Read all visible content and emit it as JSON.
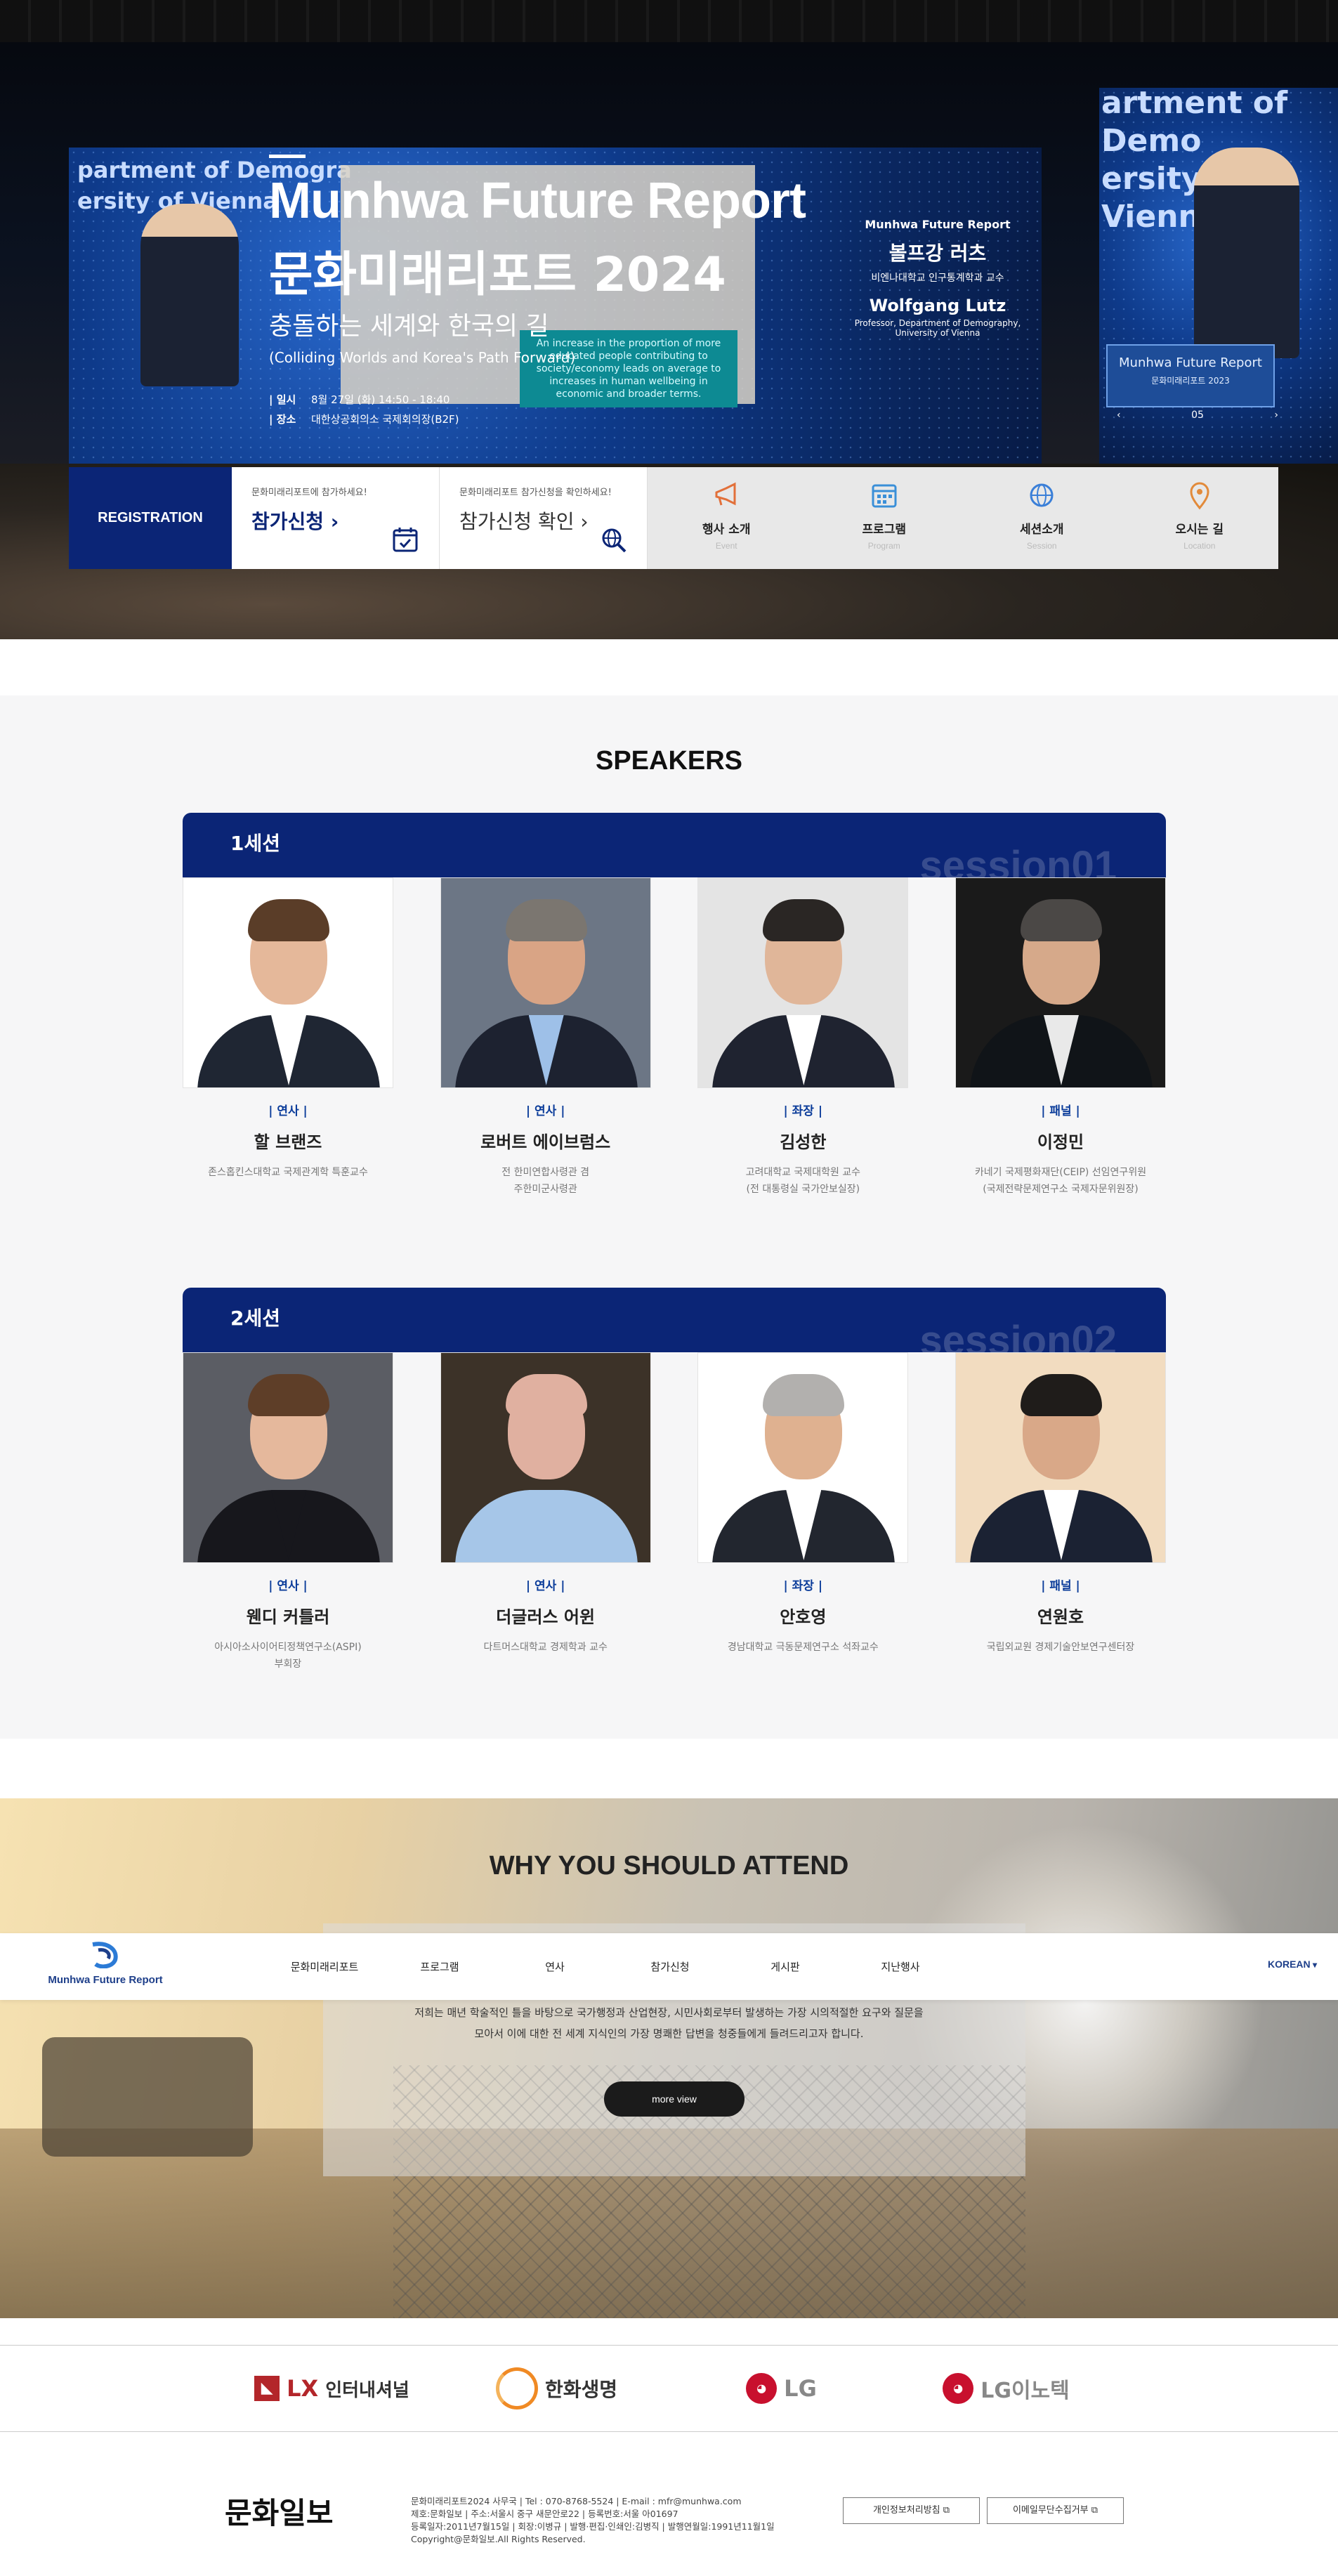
{
  "hero": {
    "title_en": "Munhwa Future Report",
    "title_ko": "문화미래리포트 2024",
    "subtitle_ko": "충돌하는 세계와 한국의 길",
    "subtitle_en": "(Colliding Worlds and Korea's Path Forward)",
    "date_label": "일시",
    "date_value": "8월 27일 (화) 14:50 - 18:40",
    "place_label": "장소",
    "place_value": "대한상공회의소 국제회의장(B2F)",
    "screen_left_text": "partment of Demogra\nersity of Vienna",
    "screen_side_text": "artment of Demo\nersity of Vienna",
    "screen_card": "Munhwa Future Report",
    "screen_card_sub": "문화미래리포트 2023",
    "pager_current": "05",
    "slide_text": "An increase in the proportion of more educated people contributing to society/economy leads on average to increases in human wellbeing in economic and broader terms.",
    "speaker_slide": {
      "brand": "Munhwa Future Report",
      "name_ko": "볼프강 러츠",
      "affil_ko": "비엔나대학교 인구통계학과 교수",
      "name_en": "Wolfgang Lutz",
      "affil_en": "Professor, Department of Demography, University of Vienna"
    }
  },
  "quickbar": {
    "registration": "REGISTRATION",
    "apply_small": "문화미래리포트에 참가하세요!",
    "apply_big": "참가신청 ›",
    "check_small": "문화미래리포트 참가신청을 확인하세요!",
    "check_big": "참가신청 확인 ›",
    "cells": [
      {
        "label": "행사 소개",
        "sub": "Event",
        "icon": "megaphone-icon",
        "color": "#e2703a"
      },
      {
        "label": "프로그램",
        "sub": "Program",
        "icon": "calendar-icon",
        "color": "#3a8fd8"
      },
      {
        "label": "세션소개",
        "sub": "Session",
        "icon": "globe-icon",
        "color": "#3a7fd8"
      },
      {
        "label": "오시는 길",
        "sub": "Location",
        "icon": "location-pin-icon",
        "color": "#e28a3a"
      }
    ]
  },
  "speakers": {
    "title": "SPEAKERS",
    "sessions": [
      {
        "label": "1세션",
        "watermark": "session01",
        "people": [
          {
            "role": "연사",
            "name": "할 브랜즈",
            "desc": "존스홉킨스대학교 국제관계학 특훈교수",
            "bg": "#ffffff",
            "skin": "#e5b89a",
            "hair": "#5a3d28",
            "suit": "#1f2633",
            "shirt": "#ffffff"
          },
          {
            "role": "연사",
            "name": "로버트 에이브럼스",
            "desc": "전 한미연합사령관 겸\n주한미군사령관",
            "bg": "#6c7685",
            "skin": "#d9a485",
            "hair": "#7b7670",
            "suit": "#1d2230",
            "shirt": "#9ec0e8"
          },
          {
            "role": "좌장",
            "name": "김성한",
            "desc": "고려대학교 국제대학원 교수\n(전 대통령실 국가안보실장)",
            "bg": "#e4e4e4",
            "skin": "#e0b699",
            "hair": "#2a2624",
            "suit": "#1f2330",
            "shirt": "#ffffff"
          },
          {
            "role": "패널",
            "name": "이정민",
            "desc": "카네기 국제평화재단(CEIP) 선임연구위원\n(국제전략문제연구소 국제자문위원장)",
            "bg": "#1a1a1a",
            "skin": "#d6a98a",
            "hair": "#4b4846",
            "suit": "#101418",
            "shirt": "#e9e9e9"
          }
        ]
      },
      {
        "label": "2세션",
        "watermark": "session02",
        "people": [
          {
            "role": "연사",
            "name": "웬디 커틀러",
            "desc": "아시아소사이어티정책연구소(ASPI)\n부회장",
            "bg": "#5b5d64",
            "skin": "#e5b89c",
            "hair": "#5e3e28",
            "suit": "#17171c",
            "shirt": "#17171c"
          },
          {
            "role": "연사",
            "name": "더글러스 어윈",
            "desc": "다트머스대학교 경제학과 교수",
            "bg": "#3c3228",
            "skin": "#e0b0a0",
            "hair": "#e0b0a0",
            "suit": "#a6c6e8",
            "shirt": "#a6c6e8"
          },
          {
            "role": "좌장",
            "name": "안호영",
            "desc": "경남대학교 극동문제연구소 석좌교수",
            "bg": "#ffffff",
            "skin": "#dfb190",
            "hair": "#b2b0ae",
            "suit": "#22262f",
            "shirt": "#ffffff"
          },
          {
            "role": "패널",
            "name": "연원호",
            "desc": "국립외교원 경제기술안보연구센터장",
            "bg": "#f2dcc0",
            "skin": "#d9a888",
            "hair": "#1f1c1a",
            "suit": "#1b2233",
            "shirt": "#ffffff"
          }
        ]
      }
    ]
  },
  "why": {
    "title": "WHY YOU SHOULD ATTEND",
    "body_line1": "저희는 매년 학술적인 틀을 바탕으로 국가행정과 산업현장, 시민사회로부터 발생하는 가장 시의적절한 요구와 질문을",
    "body_line2": "모아서 이에 대한 전 세계 지식인의 가장 명쾌한 답변을 청중들에게 들려드리고자 합니다.",
    "more": "more view"
  },
  "nav": {
    "logo_text": "Munhwa Future Report",
    "items": [
      "문화미래리포트",
      "프로그램",
      "연사",
      "참가신청",
      "게시판",
      "지난행사"
    ],
    "lang": "KOREAN"
  },
  "sponsors": [
    {
      "name": "인터내셔널",
      "mark": "LX"
    },
    {
      "name": "한화생명",
      "mark": ""
    },
    {
      "name": "LG",
      "mark": "LG"
    },
    {
      "name": "LG이노텍",
      "mark": "LG"
    }
  ],
  "footer": {
    "logo": "문화일보",
    "line1": "문화미래리포트2024 사무국  |  Tel : 070-8768-5524  |  E-mail : mfr@munhwa.com",
    "line2": "제호:문화일보 | 주소:서울시 중구 새문안로22 | 등록번호:서울 아01697",
    "line3": "등록일자:2011년7월15일 | 회장:이병규 | 발행·편집·인쇄인:김병직 | 발행연월일:1991년11월1일",
    "line4": "Copyright@문화일보.All Rights Reserved.",
    "btn_privacy": "개인정보처리방침",
    "btn_email": "이메일무단수집거부"
  }
}
